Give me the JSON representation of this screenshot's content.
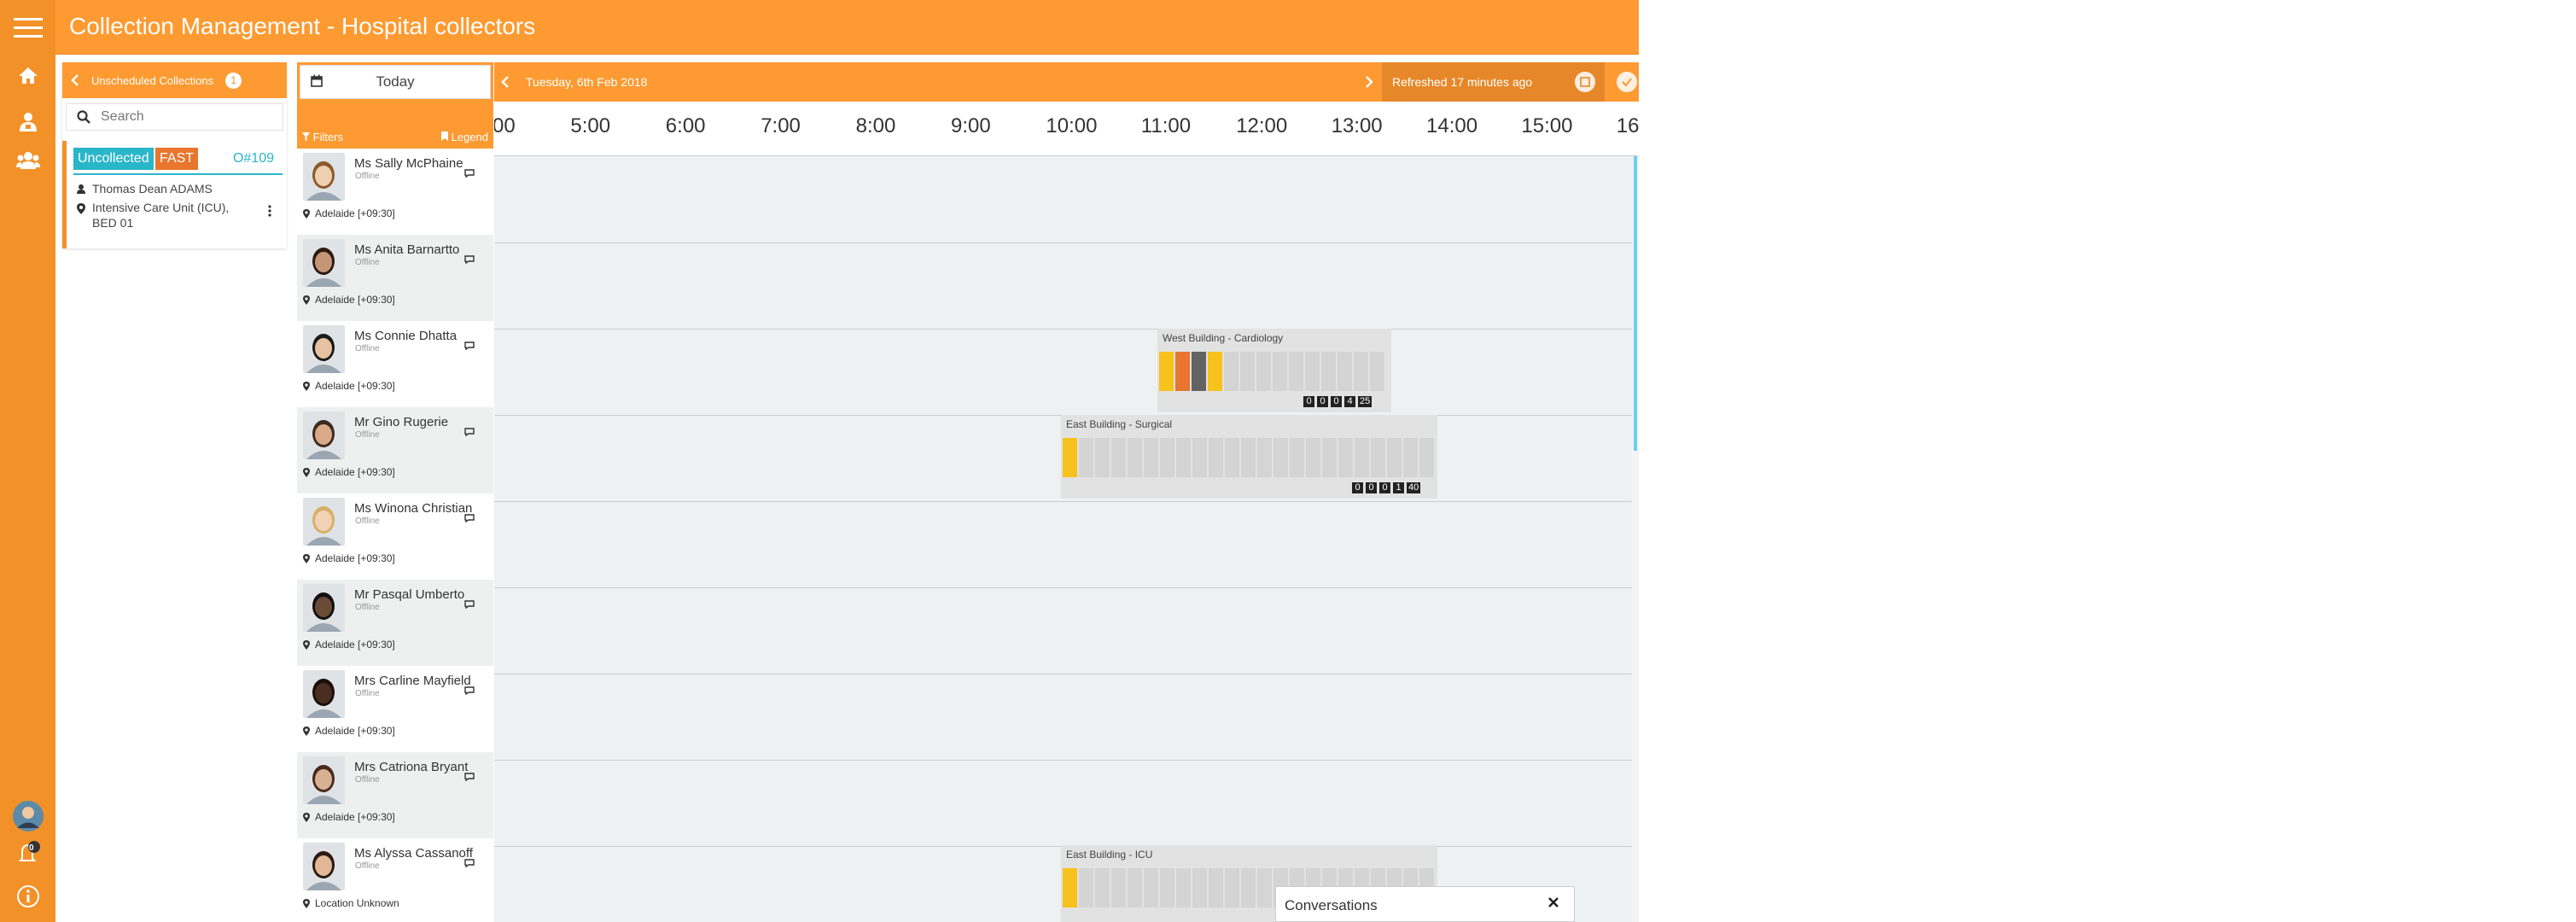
{
  "app": {
    "title": "Collection Management - Hospital collectors"
  },
  "nav": {
    "notification_count": "0"
  },
  "unscheduled": {
    "title": "Unscheduled Collections",
    "count": "1",
    "search_placeholder": "Search",
    "card": {
      "status": "Uncollected",
      "priority": "FAST",
      "order": "O#109",
      "patient": "Thomas Dean ADAMS",
      "location_line1": "Intensive Care Unit (ICU),",
      "location_line2": "BED 01"
    }
  },
  "controls": {
    "today": "Today",
    "filters": "Filters",
    "legend": "Legend"
  },
  "datebar": {
    "date": "Tuesday, 6th Feb 2018"
  },
  "refresh": {
    "label": "Refreshed 17 minutes ago"
  },
  "timeline": {
    "hours": [
      "00",
      "5:00",
      "6:00",
      "7:00",
      "8:00",
      "9:00",
      "10:00",
      "11:00",
      "12:00",
      "13:00",
      "14:00",
      "15:00",
      "16:"
    ]
  },
  "collectors": [
    {
      "name": "Ms Sally McPhaine",
      "status": "Offline",
      "location": "Adelaide [+09:30]"
    },
    {
      "name": "Ms Anita Barnartto",
      "status": "Offline",
      "location": "Adelaide [+09:30]"
    },
    {
      "name": "Ms Connie Dhatta",
      "status": "Offline",
      "location": "Adelaide [+09:30]"
    },
    {
      "name": "Mr Gino Rugerie",
      "status": "Offline",
      "location": "Adelaide [+09:30]"
    },
    {
      "name": "Ms Winona Christian",
      "status": "Offline",
      "location": "Adelaide [+09:30]"
    },
    {
      "name": "Mr Pasqal Umberto",
      "status": "Offline",
      "location": "Adelaide [+09:30]"
    },
    {
      "name": "Mrs Carline Mayfield",
      "status": "Offline",
      "location": "Adelaide [+09:30]"
    },
    {
      "name": "Mrs Catriona Bryant",
      "status": "Offline",
      "location": "Adelaide [+09:30]"
    },
    {
      "name": "Ms Alyssa Cassanoff",
      "status": "Offline",
      "location": "Location Unknown"
    }
  ],
  "blocks": [
    {
      "label": "West Building - Cardiology",
      "counts": [
        "0",
        "0",
        "0",
        "4",
        "25"
      ]
    },
    {
      "label": "East Building - Surgical",
      "counts": [
        "0",
        "0",
        "0",
        "1",
        "40"
      ]
    },
    {
      "label": "East Building - ICU",
      "counts": []
    }
  ],
  "conversations": {
    "title": "Conversations"
  }
}
